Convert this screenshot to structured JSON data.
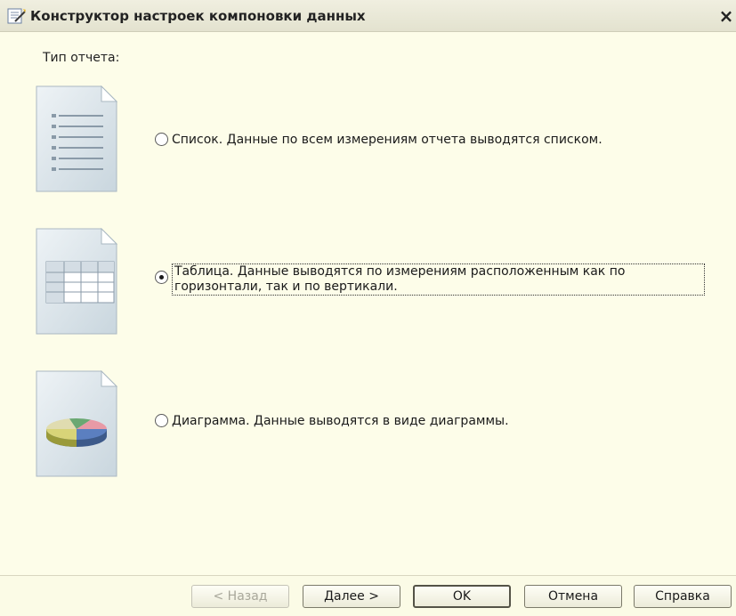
{
  "window": {
    "title": "Конструктор настроек компоновки данных",
    "close_glyph": "×"
  },
  "report_type": {
    "label": "Тип отчета:",
    "options": [
      {
        "label": "Список. Данные по всем измерениям отчета выводятся списком.",
        "selected": false,
        "icon": "list-doc-icon"
      },
      {
        "label": "Таблица. Данные выводятся по измерениям расположенным как по горизонтали, так и по вертикали.",
        "selected": true,
        "icon": "table-doc-icon"
      },
      {
        "label": "Диаграмма. Данные выводятся в виде диаграммы.",
        "selected": false,
        "icon": "chart-doc-icon"
      }
    ]
  },
  "buttons": {
    "back": "< Назад",
    "next": "Далее >",
    "ok": "OK",
    "cancel": "Отмена",
    "help": "Справка"
  }
}
